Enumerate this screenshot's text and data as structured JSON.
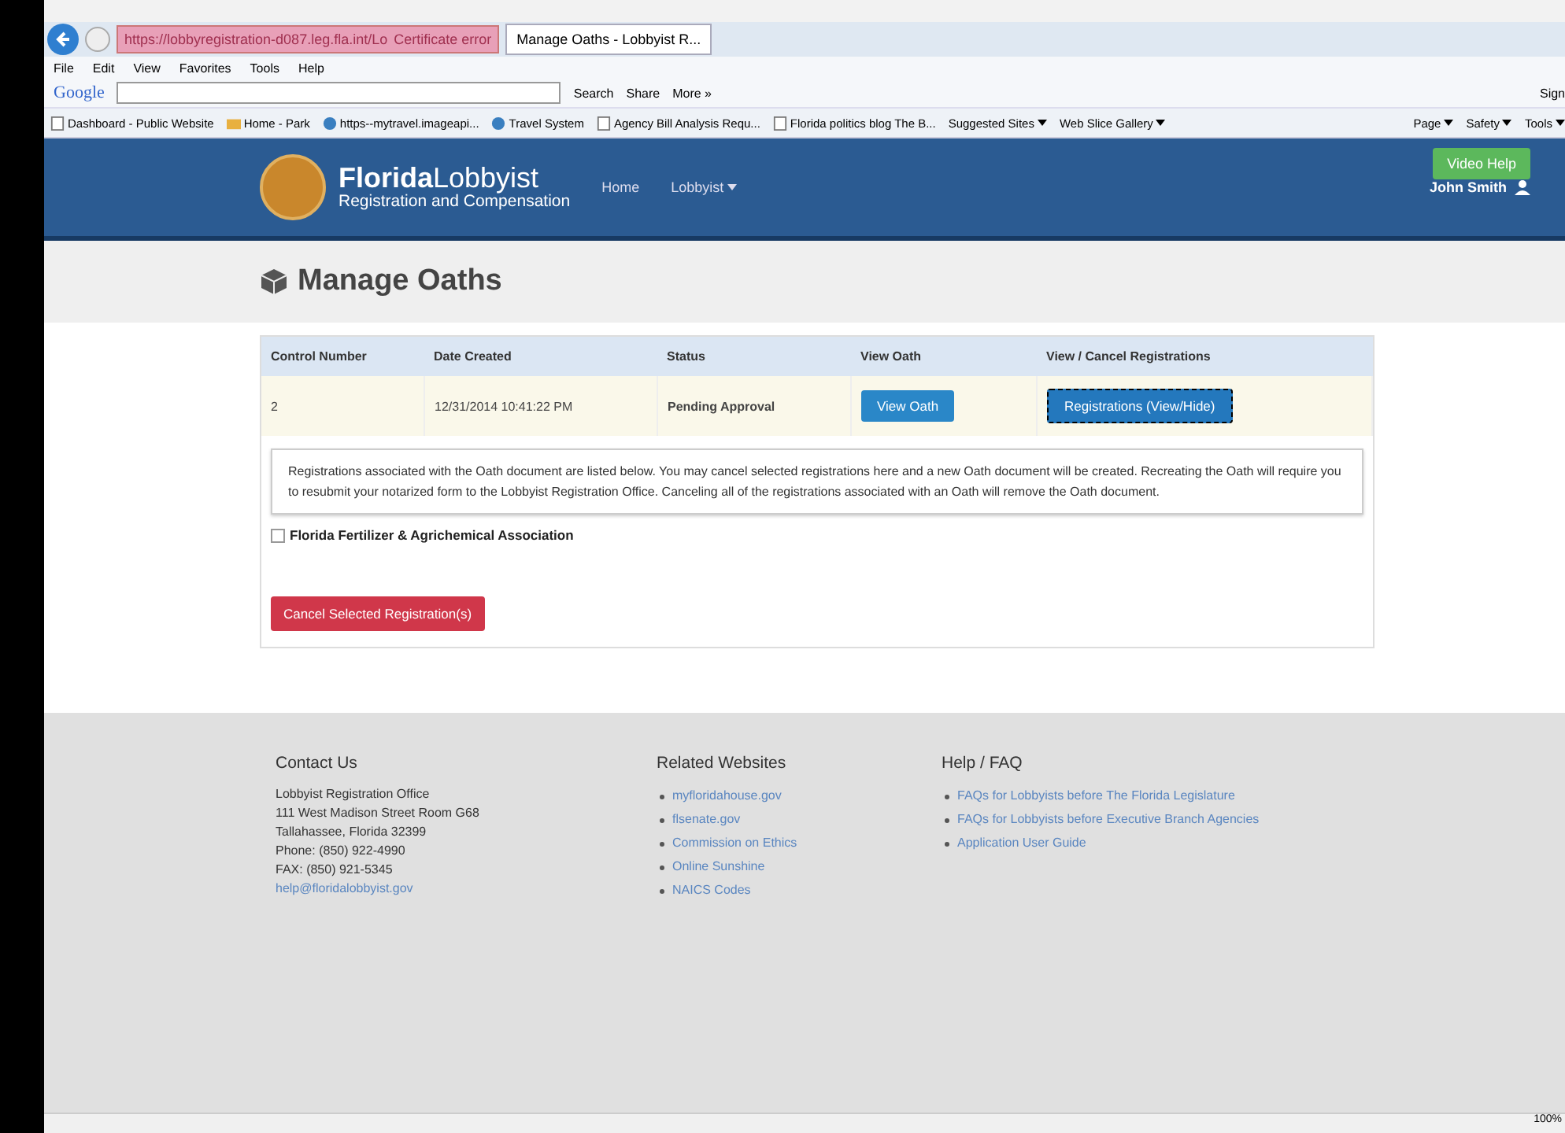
{
  "browser": {
    "address": "https://lobbyregistration-d087.leg.fla.int/Lo",
    "certificate": "Certificate error",
    "tabs": [
      {
        "label": "Manage Oaths - Lobbyist R...",
        "selected": true
      }
    ],
    "menu": [
      "File",
      "Edit",
      "View",
      "Favorites",
      "Tools",
      "Help"
    ],
    "toolbar": {
      "brand": "Google",
      "search": "Search",
      "share": "Share",
      "more": "More »",
      "sign_in": "Sign"
    },
    "favorites": [
      {
        "label": "Dashboard - Public Website",
        "kind": "page"
      },
      {
        "label": "Home - Park",
        "kind": "folder"
      },
      {
        "label": "https--mytravel.imageapi...",
        "kind": "globe"
      },
      {
        "label": "Travel System",
        "kind": "globe"
      },
      {
        "label": "Agency Bill Analysis Requ...",
        "kind": "page"
      },
      {
        "label": "Florida politics blog The B...",
        "kind": "page"
      },
      {
        "label": "Suggested Sites",
        "kind": "menu"
      },
      {
        "label": "Web Slice Gallery",
        "kind": "menu"
      }
    ],
    "commands": [
      "Page",
      "Safety",
      "Tools"
    ],
    "zoom": "100%"
  },
  "header": {
    "brand_bold": "Florida",
    "brand_light": "Lobbyist",
    "subtitle": "Registration and Compensation",
    "nav": [
      {
        "label": "Home",
        "dropdown": false
      },
      {
        "label": "Lobbyist",
        "dropdown": true
      }
    ],
    "help_button": "Video Help",
    "user": "John Smith"
  },
  "page_title": "Manage Oaths",
  "table": {
    "columns": [
      "Control Number",
      "Date Created",
      "Status",
      "View Oath",
      "View / Cancel Registrations"
    ],
    "rows": [
      {
        "control": "2",
        "date": "12/31/2014 10:41:22 PM",
        "status": "Pending Approval",
        "view_button": "View Oath",
        "registrations_button": "Registrations (View/Hide)"
      }
    ]
  },
  "notice": "Registrations associated with the Oath document are listed below. You may cancel selected registrations here and a new Oath document will be created. Recreating the Oath will require you to resubmit your notarized form to the Lobbyist Registration Office. Canceling all of the registrations associated with an Oath will remove the Oath document.",
  "registrations": [
    {
      "label": "Florida Fertilizer & Agrichemical Association",
      "checked": false
    }
  ],
  "cancel_button": "Cancel Selected Registration(s)",
  "footer": {
    "contact": {
      "title": "Contact Us",
      "lines": [
        "Lobbyist Registration Office",
        "111 West Madison Street Room G68",
        "Tallahassee, Florida 32399",
        "Phone: (850) 922-4990",
        "FAX: (850) 921-5345"
      ],
      "email": "help@floridalobbyist.gov"
    },
    "related": {
      "title": "Related Websites",
      "links": [
        "myfloridahouse.gov",
        "flsenate.gov",
        "Commission on Ethics",
        "Online Sunshine",
        "NAICS Codes"
      ]
    },
    "help": {
      "title": "Help / FAQ",
      "links": [
        "FAQs for Lobbyists before The Florida Legislature",
        "FAQs for Lobbyists before Executive Branch Agencies",
        "Application User Guide"
      ]
    }
  }
}
